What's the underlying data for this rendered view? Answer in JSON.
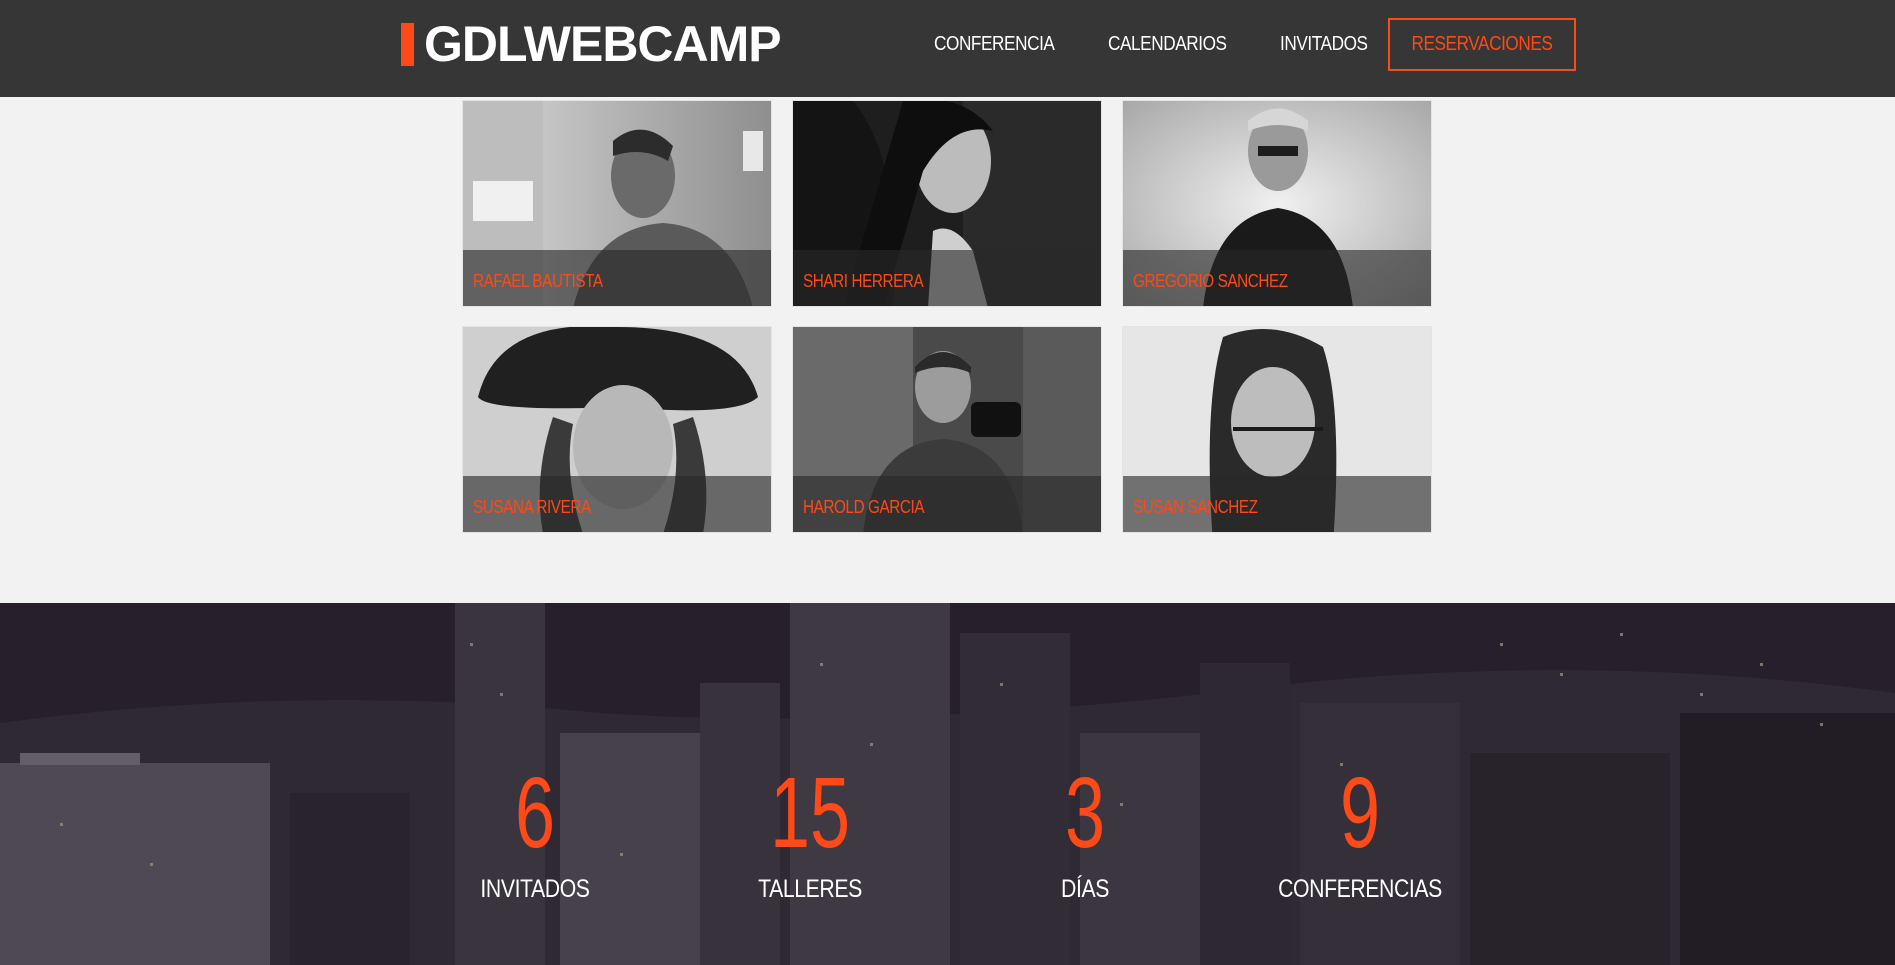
{
  "header": {
    "logo_text": "GDLWEBCAMP",
    "nav": [
      "CONFERENCIA",
      "CALENDARIOS",
      "INVITADOS"
    ],
    "cta": "RESERVACIONES"
  },
  "speakers": [
    {
      "name": "RAFAEL BAUTISTA"
    },
    {
      "name": "SHARI HERRERA"
    },
    {
      "name": "GREGORIO SANCHEZ"
    },
    {
      "name": "SUSANA RIVERA"
    },
    {
      "name": "HAROLD GARCIA"
    },
    {
      "name": "SUSAN SANCHEZ"
    }
  ],
  "stats": [
    {
      "value": "6",
      "label": "INVITADOS"
    },
    {
      "value": "15",
      "label": "TALLERES"
    },
    {
      "value": "3",
      "label": "DÍAS"
    },
    {
      "value": "9",
      "label": "CONFERENCIAS"
    }
  ],
  "colors": {
    "accent": "#fe4918",
    "header_bg": "#363636",
    "page_bg": "#f2f2f2"
  }
}
